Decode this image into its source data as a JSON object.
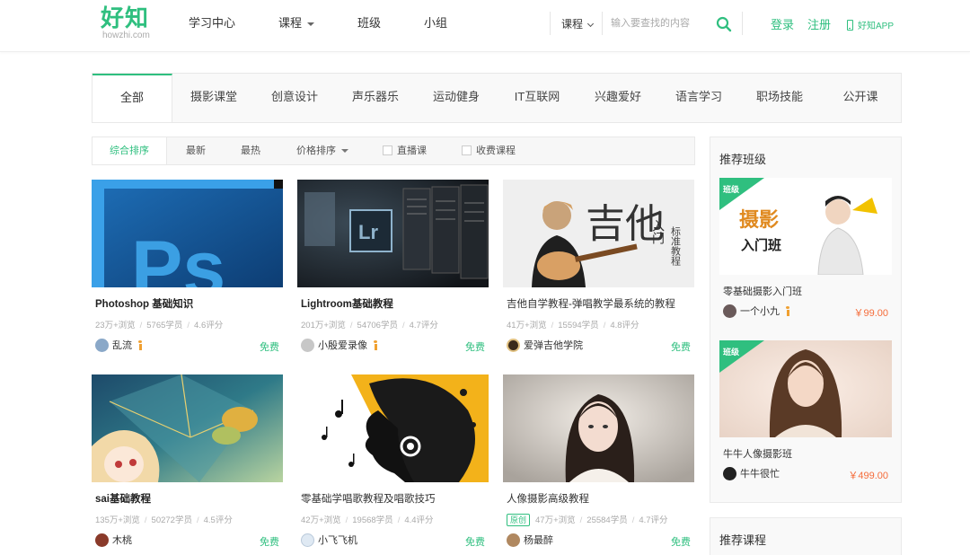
{
  "logo": {
    "main": "好知",
    "sub": "howzhi.com"
  },
  "nav": {
    "items": [
      "学习中心",
      "课程",
      "班级",
      "小组"
    ]
  },
  "search": {
    "category": "课程",
    "placeholder": "输入要查找的内容"
  },
  "account": {
    "login": "登录",
    "register": "注册",
    "app": "好知APP"
  },
  "categories": [
    "全部",
    "摄影课堂",
    "创意设计",
    "声乐器乐",
    "运动健身",
    "IT互联网",
    "兴趣爱好",
    "语言学习",
    "职场技能",
    "公开课"
  ],
  "filters": {
    "comprehensive": "综合排序",
    "newest": "最新",
    "hottest": "最热",
    "price": "价格排序",
    "live": "直播课",
    "paid": "收费课程"
  },
  "courses": [
    {
      "title": "Photoshop 基础知识",
      "views": "23万+浏览",
      "students": "5765学员",
      "rating": "4.6评分",
      "author": "乱流",
      "price": "免费",
      "verified": true
    },
    {
      "title": "Lightroom基础教程",
      "views": "201万+浏览",
      "students": "54706学员",
      "rating": "4.7评分",
      "author": "小殷爱录像",
      "price": "免费",
      "verified": true
    },
    {
      "title": "吉他自学教程-弹唱教学最系统的教程",
      "views": "41万+浏览",
      "students": "15594学员",
      "rating": "4.8评分",
      "author": "爱弹吉他学院",
      "price": "免费",
      "verified": false
    },
    {
      "title": "sai基础教程",
      "views": "135万+浏览",
      "students": "50272学员",
      "rating": "4.5评分",
      "author": "木桃",
      "price": "免费",
      "verified": false
    },
    {
      "title": "零基础学唱歌教程及唱歌技巧",
      "views": "42万+浏览",
      "students": "19568学员",
      "rating": "4.4评分",
      "author": "小飞飞机",
      "price": "免费",
      "verified": false
    },
    {
      "title": "人像摄影高级教程",
      "badge": "原创",
      "views": "47万+浏览",
      "students": "25584学员",
      "rating": "4.7评分",
      "author": "杨最醉",
      "price": "免费",
      "verified": false
    }
  ],
  "thumb_text": {
    "ps": "Ps",
    "lr": "Lr",
    "guitar_main": "吉他",
    "guitar_sub1": "入门",
    "guitar_sub2": "标准教程",
    "class1_text1": "摄影",
    "class1_text2": "入门班"
  },
  "sidebar": {
    "title": "推荐班级",
    "badge": "班级",
    "classes": [
      {
        "name": "零基础摄影入门班",
        "teacher": "一个小九",
        "price": "￥99.00",
        "verified": true
      },
      {
        "name": "牛牛人像摄影班",
        "teacher": "牛牛很忙",
        "price": "￥499.00",
        "verified": false
      }
    ],
    "title2": "推荐课程"
  },
  "colors": {
    "brand": "#2fbf7f",
    "price": "#f56c3a",
    "verified": "#f0a030"
  }
}
